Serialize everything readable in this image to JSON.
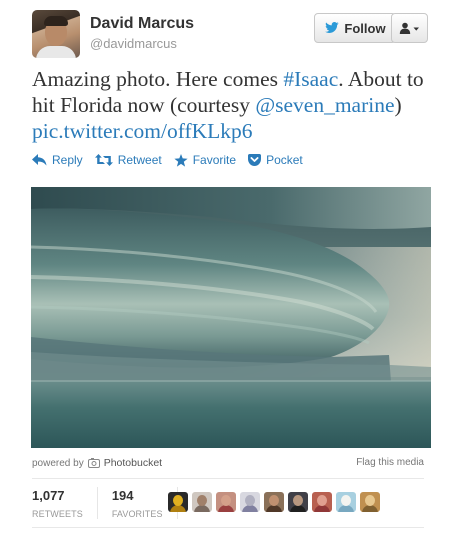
{
  "user": {
    "name": "David Marcus",
    "handle": "@davidmarcus"
  },
  "follow_button": {
    "label": "Follow"
  },
  "tweet": {
    "text_before": "Amazing photo. Here comes ",
    "hashtag": "#Isaac",
    "text_middle": ". About to hit Florida now (courtesy ",
    "mention": "@seven_marine",
    "text_after": ") ",
    "pic_link": "pic.twitter.com/offKLkp6"
  },
  "actions": {
    "reply": "Reply",
    "retweet": "Retweet",
    "favorite": "Favorite",
    "pocket": "Pocket"
  },
  "media": {
    "powered_by": "powered by",
    "provider": "Photobucket",
    "flag": "Flag this media"
  },
  "stats": {
    "retweets_count": "1,077",
    "retweets_label": "RETWEETS",
    "favorites_count": "194",
    "favorites_label": "FAVORITES"
  },
  "colors": {
    "link": "#2b7bb9",
    "text": "#333333",
    "muted": "#999999"
  },
  "favoriter_avatars": [
    {
      "bg": "#2a2a2a",
      "face": "#e0b020",
      "shirt": "#b08010"
    },
    {
      "bg": "#cfc7c0",
      "face": "#a0806a",
      "shirt": "#7a6a60"
    },
    {
      "bg": "#c49080",
      "face": "#d4a08a",
      "shirt": "#9a4040"
    },
    {
      "bg": "#d8d8e0",
      "face": "#b0b0c0",
      "shirt": "#8080a0"
    },
    {
      "bg": "#8a7058",
      "face": "#c09070",
      "shirt": "#503828"
    },
    {
      "bg": "#404048",
      "face": "#b89880",
      "shirt": "#202020"
    },
    {
      "bg": "#b86050",
      "face": "#e0a090",
      "shirt": "#903838"
    },
    {
      "bg": "#a8d0e0",
      "face": "#f4f4f0",
      "shirt": "#78a8c0"
    },
    {
      "bg": "#c09050",
      "face": "#e8c890",
      "shirt": "#806030"
    }
  ]
}
